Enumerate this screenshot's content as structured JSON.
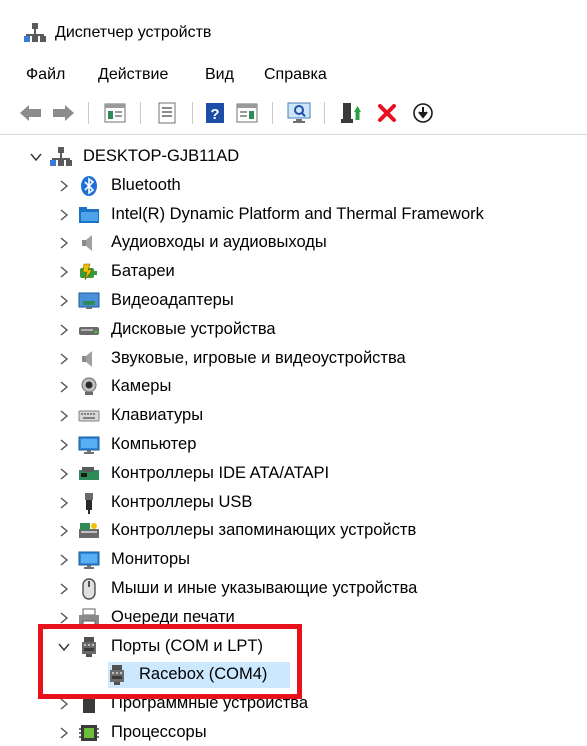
{
  "window": {
    "title": "Диспетчер устройств"
  },
  "menu": [
    {
      "label": "Файл"
    },
    {
      "label": "Действие"
    },
    {
      "label": "Вид"
    },
    {
      "label": "Справка"
    }
  ],
  "toolbar": [
    {
      "name": "back-button",
      "icon": "arrow-left-icon"
    },
    {
      "name": "forward-button",
      "icon": "arrow-right-icon"
    },
    {
      "name": "show-hide-console-tree-button",
      "icon": "console-tree-icon"
    },
    {
      "name": "properties-button",
      "icon": "properties-icon"
    },
    {
      "name": "help-button",
      "icon": "help-icon"
    },
    {
      "name": "show-action-pane-button",
      "icon": "action-pane-icon"
    },
    {
      "name": "scan-hardware-button",
      "icon": "monitor-scan-icon"
    },
    {
      "name": "update-driver-button",
      "icon": "update-driver-icon"
    },
    {
      "name": "uninstall-device-button",
      "icon": "red-x-icon"
    },
    {
      "name": "disable-device-button",
      "icon": "down-arrow-circle-icon"
    }
  ],
  "tree": {
    "root": {
      "label": "DESKTOP-GJB11AD",
      "icon": "computer-network-icon",
      "expanded": true
    },
    "categories": [
      {
        "label": "Bluetooth",
        "icon": "bluetooth-icon"
      },
      {
        "label": "Intel(R) Dynamic Platform and Thermal Framework",
        "icon": "folder-icon"
      },
      {
        "label": "Аудиовходы и аудиовыходы",
        "icon": "speaker-icon"
      },
      {
        "label": "Батареи",
        "icon": "battery-icon"
      },
      {
        "label": "Видеоадаптеры",
        "icon": "display-adapter-icon"
      },
      {
        "label": "Дисковые устройства",
        "icon": "disk-drive-icon"
      },
      {
        "label": "Звуковые, игровые и видеоустройства",
        "icon": "speaker-icon"
      },
      {
        "label": "Камеры",
        "icon": "camera-icon"
      },
      {
        "label": "Клавиатуры",
        "icon": "keyboard-icon"
      },
      {
        "label": "Компьютер",
        "icon": "monitor-icon"
      },
      {
        "label": "Контроллеры IDE ATA/ATAPI",
        "icon": "ide-controller-icon"
      },
      {
        "label": "Контроллеры USB",
        "icon": "usb-icon"
      },
      {
        "label": "Контроллеры запоминающих устройств",
        "icon": "storage-controller-icon"
      },
      {
        "label": "Мониторы",
        "icon": "monitor-icon"
      },
      {
        "label": "Мыши и иные указывающие устройства",
        "icon": "mouse-icon"
      },
      {
        "label": "Очереди печати",
        "icon": "printer-icon"
      },
      {
        "label": "Порты (COM и LPT)",
        "icon": "port-icon",
        "expanded": true,
        "children": [
          {
            "label": "Racebox (COM4)",
            "icon": "port-icon",
            "selected": true
          }
        ]
      },
      {
        "label": "Программные устройства",
        "icon": "software-device-icon"
      },
      {
        "label": "Процессоры",
        "icon": "processor-icon"
      }
    ]
  },
  "colors": {
    "selection": "#cce8ff",
    "highlight": "#e8101b",
    "accent": "#1a73c7"
  }
}
